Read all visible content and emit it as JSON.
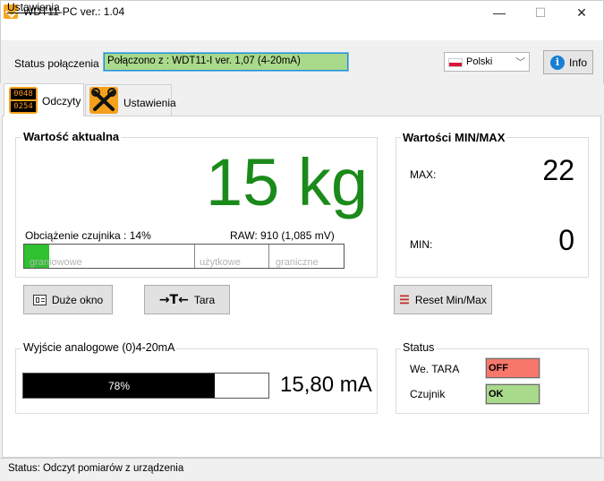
{
  "window": {
    "title": "WDT11-PC  ver.: 1.04",
    "minimize": "—",
    "maximize": "☐",
    "close": "✕"
  },
  "menu": {
    "settings": "Ustawienia"
  },
  "connection": {
    "label": "Status połączenia",
    "value": "Połączono z : WDT11-I ver. 1,07 (4-20mA)"
  },
  "language": {
    "selected": "Polski"
  },
  "info_button": {
    "label": "Info",
    "icon": "i"
  },
  "tabs": [
    {
      "label": "Odczyty",
      "icon_text_1": "0048",
      "icon_text_2": "0254"
    },
    {
      "label": "Ustawienia"
    }
  ],
  "current_value": {
    "title": "Wartość aktualna",
    "value": "15 kg",
    "load_label": "Obciążenie czujnika :  14%",
    "raw_label": "RAW: 910 (1,085 mV)",
    "load_percent": 14,
    "zones": [
      "graniowowe",
      "użytkowe",
      "graniczne"
    ]
  },
  "minmax": {
    "title": "Wartości MIN/MAX",
    "max_label": "MAX:",
    "max_value": "22",
    "min_label": "MIN:",
    "min_value": "0"
  },
  "buttons": {
    "big_window": "Duże okno",
    "tare": "Tara",
    "reset": "Reset Min/Max"
  },
  "analog": {
    "title": "Wyjście analogowe (0)4-20mA",
    "percent": 78,
    "percent_label": "78%",
    "value": "15,80 mA"
  },
  "status": {
    "title": "Status",
    "tara_label": "We. TARA",
    "tara_value": "OFF",
    "tara_color": "#f7786b",
    "sensor_label": "Czujnik",
    "sensor_value": "OK",
    "sensor_color": "#a9d98b"
  },
  "statusbar": {
    "text": "Status:  Odczyt pomiarów z urządzenia"
  }
}
